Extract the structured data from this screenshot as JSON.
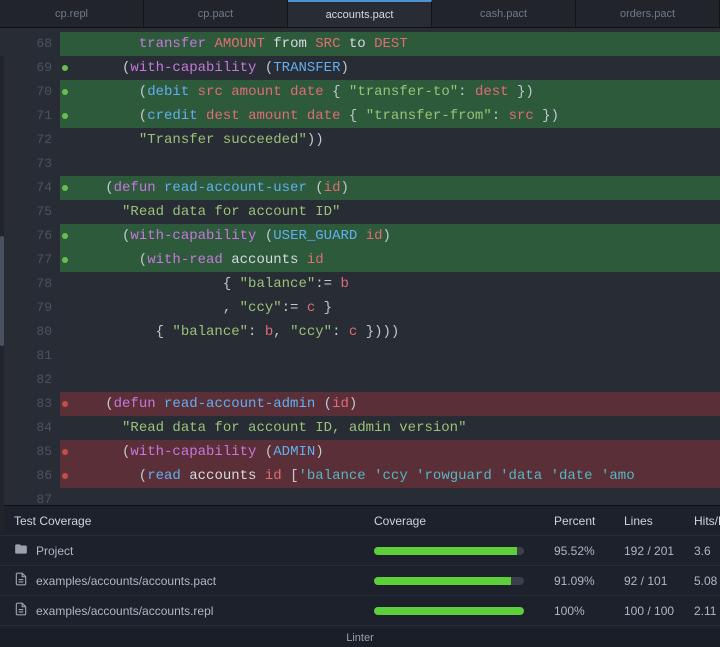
{
  "tabs": [
    {
      "label": "cp.repl",
      "active": false
    },
    {
      "label": "cp.pact",
      "active": false
    },
    {
      "label": "accounts.pact",
      "active": true
    },
    {
      "label": "cash.pact",
      "active": false
    },
    {
      "label": "orders.pact",
      "active": false
    }
  ],
  "lines": [
    {
      "n": "68",
      "mark": "",
      "hl": "green",
      "tokens": [
        [
          "p",
          "       "
        ],
        [
          "kw",
          "transfer"
        ],
        [
          "p",
          " "
        ],
        [
          "id",
          "AMOUNT"
        ],
        [
          "p",
          " "
        ],
        [
          "wt",
          "from"
        ],
        [
          "p",
          " "
        ],
        [
          "id",
          "SRC"
        ],
        [
          "p",
          " "
        ],
        [
          "wt",
          "to"
        ],
        [
          "p",
          " "
        ],
        [
          "id",
          "DEST"
        ]
      ]
    },
    {
      "n": "69",
      "mark": "g",
      "hl": "",
      "tokens": [
        [
          "p",
          "     ("
        ],
        [
          "kw",
          "with-capability"
        ],
        [
          "p",
          " ("
        ],
        [
          "fn",
          "TRANSFER"
        ],
        [
          "p",
          ")"
        ]
      ]
    },
    {
      "n": "70",
      "mark": "g",
      "hl": "green",
      "tokens": [
        [
          "p",
          "       ("
        ],
        [
          "fn",
          "debit"
        ],
        [
          "p",
          " "
        ],
        [
          "id",
          "src"
        ],
        [
          "p",
          " "
        ],
        [
          "id",
          "amount"
        ],
        [
          "p",
          " "
        ],
        [
          "id",
          "date"
        ],
        [
          "p",
          " { "
        ],
        [
          "str",
          "\"transfer-to\""
        ],
        [
          "p",
          ": "
        ],
        [
          "id",
          "dest"
        ],
        [
          "p",
          " })"
        ]
      ]
    },
    {
      "n": "71",
      "mark": "g",
      "hl": "green",
      "tokens": [
        [
          "p",
          "       ("
        ],
        [
          "fn",
          "credit"
        ],
        [
          "p",
          " "
        ],
        [
          "id",
          "dest"
        ],
        [
          "p",
          " "
        ],
        [
          "id",
          "amount"
        ],
        [
          "p",
          " "
        ],
        [
          "id",
          "date"
        ],
        [
          "p",
          " { "
        ],
        [
          "str",
          "\"transfer-from\""
        ],
        [
          "p",
          ": "
        ],
        [
          "id",
          "src"
        ],
        [
          "p",
          " })"
        ]
      ]
    },
    {
      "n": "72",
      "mark": "",
      "hl": "",
      "tokens": [
        [
          "p",
          "       "
        ],
        [
          "str",
          "\"Transfer succeeded\""
        ],
        [
          "p",
          "))"
        ]
      ]
    },
    {
      "n": "73",
      "mark": "",
      "hl": "",
      "tokens": [
        [
          "p",
          ""
        ]
      ]
    },
    {
      "n": "74",
      "mark": "g",
      "hl": "green",
      "tokens": [
        [
          "p",
          "   ("
        ],
        [
          "kw",
          "defun"
        ],
        [
          "p",
          " "
        ],
        [
          "fn",
          "read-account-user"
        ],
        [
          "p",
          " ("
        ],
        [
          "id",
          "id"
        ],
        [
          "p",
          ")"
        ]
      ]
    },
    {
      "n": "75",
      "mark": "",
      "hl": "",
      "tokens": [
        [
          "p",
          "     "
        ],
        [
          "str",
          "\"Read data for account ID\""
        ]
      ]
    },
    {
      "n": "76",
      "mark": "g",
      "hl": "green",
      "tokens": [
        [
          "p",
          "     ("
        ],
        [
          "kw",
          "with-capability"
        ],
        [
          "p",
          " ("
        ],
        [
          "fn",
          "USER_GUARD"
        ],
        [
          "p",
          " "
        ],
        [
          "id",
          "id"
        ],
        [
          "p",
          ")"
        ]
      ]
    },
    {
      "n": "77",
      "mark": "g",
      "hl": "green",
      "tokens": [
        [
          "p",
          "       ("
        ],
        [
          "kw",
          "with-read"
        ],
        [
          "p",
          " "
        ],
        [
          "wt",
          "accounts"
        ],
        [
          "p",
          " "
        ],
        [
          "id",
          "id"
        ]
      ]
    },
    {
      "n": "78",
      "mark": "",
      "hl": "",
      "tokens": [
        [
          "p",
          "                 { "
        ],
        [
          "str",
          "\"balance\""
        ],
        [
          "p",
          ":= "
        ],
        [
          "id",
          "b"
        ]
      ]
    },
    {
      "n": "79",
      "mark": "",
      "hl": "",
      "tokens": [
        [
          "p",
          "                 , "
        ],
        [
          "str",
          "\"ccy\""
        ],
        [
          "p",
          ":= "
        ],
        [
          "id",
          "c"
        ],
        [
          "p",
          " }"
        ]
      ]
    },
    {
      "n": "80",
      "mark": "",
      "hl": "",
      "tokens": [
        [
          "p",
          "         { "
        ],
        [
          "str",
          "\"balance\""
        ],
        [
          "p",
          ": "
        ],
        [
          "id",
          "b"
        ],
        [
          "p",
          ", "
        ],
        [
          "str",
          "\"ccy\""
        ],
        [
          "p",
          ": "
        ],
        [
          "id",
          "c"
        ],
        [
          "p",
          " })))"
        ]
      ]
    },
    {
      "n": "81",
      "mark": "",
      "hl": "",
      "tokens": [
        [
          "p",
          ""
        ]
      ]
    },
    {
      "n": "82",
      "mark": "",
      "hl": "",
      "tokens": [
        [
          "p",
          ""
        ]
      ]
    },
    {
      "n": "83",
      "mark": "r",
      "hl": "red",
      "tokens": [
        [
          "p",
          "   ("
        ],
        [
          "kw",
          "defun"
        ],
        [
          "p",
          " "
        ],
        [
          "fn",
          "read-account-admin"
        ],
        [
          "p",
          " ("
        ],
        [
          "id",
          "id"
        ],
        [
          "p",
          ")"
        ]
      ]
    },
    {
      "n": "84",
      "mark": "",
      "hl": "",
      "tokens": [
        [
          "p",
          "     "
        ],
        [
          "str",
          "\"Read data for account ID, admin version\""
        ]
      ]
    },
    {
      "n": "85",
      "mark": "r",
      "hl": "red",
      "tokens": [
        [
          "p",
          "     ("
        ],
        [
          "kw",
          "with-capability"
        ],
        [
          "p",
          " ("
        ],
        [
          "fn",
          "ADMIN"
        ],
        [
          "p",
          ")"
        ]
      ]
    },
    {
      "n": "86",
      "mark": "r",
      "hl": "red",
      "tokens": [
        [
          "p",
          "       ("
        ],
        [
          "fn",
          "read"
        ],
        [
          "p",
          " "
        ],
        [
          "wt",
          "accounts"
        ],
        [
          "p",
          " "
        ],
        [
          "id",
          "id"
        ],
        [
          "p",
          " ["
        ],
        [
          "sym",
          "'balance "
        ],
        [
          "sym",
          "'ccy "
        ],
        [
          "sym",
          "'rowguard "
        ],
        [
          "sym",
          "'data "
        ],
        [
          "sym",
          "'date "
        ],
        [
          "sym",
          "'amo"
        ]
      ]
    },
    {
      "n": "87",
      "mark": "",
      "hl": "",
      "tokens": [
        [
          "p",
          ""
        ]
      ]
    }
  ],
  "coverage": {
    "headers": {
      "name": "Test Coverage",
      "bar": "Coverage",
      "pct": "Percent",
      "lines": "Lines",
      "hits": "Hits/L"
    },
    "rows": [
      {
        "icon": "folder",
        "name": "Project",
        "pct_num": 95.52,
        "pct": "95.52%",
        "lines": "192 / 201",
        "hits": "3.6"
      },
      {
        "icon": "file",
        "name": "examples/accounts/accounts.pact",
        "pct_num": 91.09,
        "pct": "91.09%",
        "lines": "92 / 101",
        "hits": "5.08"
      },
      {
        "icon": "file",
        "name": "examples/accounts/accounts.repl",
        "pct_num": 100,
        "pct": "100%",
        "lines": "100 / 100",
        "hits": "2.11"
      }
    ]
  },
  "footer": {
    "linter": "Linter"
  }
}
